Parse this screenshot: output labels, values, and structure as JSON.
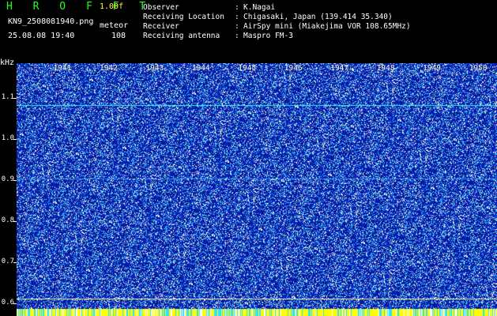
{
  "header": {
    "title": "H R O F F T",
    "version": "1.00f",
    "filename": "KN9_2508081940.png",
    "meteor_label": "meteor",
    "datetime": "25.08.08 19:40",
    "meteor_count": "108"
  },
  "metadata": {
    "rows": [
      {
        "label": "Observer",
        "colon": ":",
        "value": "K.Nagai"
      },
      {
        "label": "Receiving Location",
        "colon": ":",
        "value": "Chigasaki, Japan (139.414 35.340)"
      },
      {
        "label": "Receiver",
        "colon": ":",
        "value": "AirSpy mini (Miakejima VOR 108.65MHz)"
      },
      {
        "label": "Receiving antenna",
        "colon": ":",
        "value": "Maspro FM-3"
      }
    ]
  },
  "spectrogram": {
    "y_unit": "kHz",
    "y_ticks": [
      "1.1",
      "1.0",
      "0.9",
      "0.8",
      "0.7",
      "0.6"
    ],
    "y_range": [
      0.57,
      1.185
    ],
    "x_ticks": [
      "1941",
      "1942",
      "1943",
      "1944",
      "1945",
      "1946",
      "1947",
      "1948",
      "1949",
      "1950"
    ],
    "x_range_minutes": [
      1940,
      1950.4
    ],
    "carrier_lines_khz": [
      1.083,
      0.905,
      0.588
    ],
    "colors": {
      "background": "#001aa8",
      "noise_light": "#ffffff",
      "noise_cyan": "#40e0ff",
      "noise_yellow": "#ffff60",
      "line": "#40ffff",
      "bottom_band": "#ffff00"
    }
  }
}
